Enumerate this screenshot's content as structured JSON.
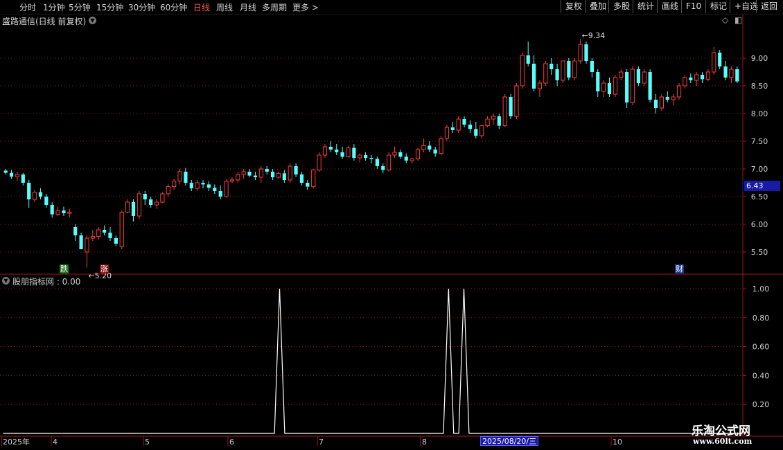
{
  "toolbar": {
    "left_items": [
      "分时",
      "1分钟",
      "5分钟",
      "15分钟",
      "30分钟",
      "60分钟",
      "日线",
      "周线",
      "月线",
      "多周期",
      "更多 >"
    ],
    "active": "日线",
    "right_items": [
      "复权",
      "叠加",
      "多股",
      "统计",
      "画线",
      "F10",
      "标记",
      "+自选",
      "返回"
    ]
  },
  "main_panel": {
    "title": "盛路通信(日线 前复权)",
    "current_price_label": "6.43",
    "high_marker": "9.34",
    "low_marker": "5.20",
    "badges": {
      "die": "跌",
      "zhang": "涨",
      "cai": "财"
    }
  },
  "indicator_panel": {
    "title": "股朋指标网 : 0.00"
  },
  "x_axis": {
    "labels": [
      "2025年",
      "4",
      "5",
      "6",
      "7",
      "8",
      "10"
    ],
    "cursor_date": "2025/08/20/三"
  },
  "watermark": {
    "line1": "乐淘公式网",
    "line2": "www.60lt.com"
  },
  "colors": {
    "up": "#ff3c3c",
    "down": "#54ffff",
    "grid": "#8a1a1a",
    "frame": "#a01818",
    "axis_text": "#d0d0d0"
  },
  "chart_data": [
    {
      "type": "candlestick",
      "title": "盛路通信(日线 前复权)",
      "yticks": [
        5.5,
        6.0,
        6.5,
        7.0,
        7.5,
        8.0,
        8.5,
        9.0
      ],
      "ylim": [
        5.1,
        9.55
      ],
      "max_marker": 9.34,
      "min_marker": 5.2,
      "last_price": 6.43,
      "ohlc": [
        [
          6.97,
          7.0,
          6.9,
          6.93
        ],
        [
          6.93,
          6.98,
          6.82,
          6.86
        ],
        [
          6.86,
          6.95,
          6.78,
          6.9
        ],
        [
          6.9,
          6.93,
          6.7,
          6.75
        ],
        [
          6.75,
          6.8,
          6.3,
          6.45
        ],
        [
          6.45,
          6.62,
          6.4,
          6.58
        ],
        [
          6.58,
          6.65,
          6.45,
          6.5
        ],
        [
          6.5,
          6.55,
          6.3,
          6.35
        ],
        [
          6.35,
          6.4,
          6.12,
          6.18
        ],
        [
          6.18,
          6.32,
          6.15,
          6.25
        ],
        [
          6.25,
          6.32,
          6.15,
          6.2
        ],
        [
          6.2,
          6.28,
          6.12,
          6.22
        ],
        [
          5.95,
          6.0,
          5.7,
          5.8
        ],
        [
          5.8,
          5.85,
          5.6,
          5.55
        ],
        [
          5.5,
          5.8,
          5.22,
          5.75
        ],
        [
          5.75,
          5.9,
          5.7,
          5.78
        ],
        [
          5.78,
          5.95,
          5.72,
          5.9
        ],
        [
          5.9,
          5.98,
          5.8,
          5.85
        ],
        [
          5.85,
          5.95,
          5.7,
          5.75
        ],
        [
          5.75,
          5.8,
          5.6,
          5.65
        ],
        [
          5.6,
          6.25,
          5.55,
          6.22
        ],
        [
          6.22,
          6.45,
          6.2,
          6.4
        ],
        [
          6.4,
          6.45,
          6.05,
          6.15
        ],
        [
          6.15,
          6.6,
          6.1,
          6.55
        ],
        [
          6.55,
          6.6,
          6.35,
          6.45
        ],
        [
          6.45,
          6.5,
          6.3,
          6.35
        ],
        [
          6.35,
          6.45,
          6.28,
          6.4
        ],
        [
          6.4,
          6.58,
          6.38,
          6.55
        ],
        [
          6.55,
          6.72,
          6.5,
          6.68
        ],
        [
          6.68,
          6.82,
          6.62,
          6.78
        ],
        [
          6.78,
          7.0,
          6.72,
          6.95
        ],
        [
          6.95,
          7.02,
          6.7,
          6.75
        ],
        [
          6.75,
          6.8,
          6.6,
          6.65
        ],
        [
          6.65,
          6.8,
          6.6,
          6.75
        ],
        [
          6.75,
          6.8,
          6.65,
          6.72
        ],
        [
          6.72,
          6.78,
          6.6,
          6.66
        ],
        [
          6.66,
          6.72,
          6.55,
          6.6
        ],
        [
          6.6,
          6.7,
          6.45,
          6.5
        ],
        [
          6.5,
          6.82,
          6.48,
          6.78
        ],
        [
          6.78,
          6.85,
          6.74,
          6.8
        ],
        [
          6.8,
          6.95,
          6.75,
          6.9
        ],
        [
          6.9,
          7.0,
          6.82,
          6.95
        ],
        [
          6.95,
          7.0,
          6.85,
          6.88
        ],
        [
          6.88,
          6.95,
          6.8,
          6.85
        ],
        [
          6.85,
          7.05,
          6.75,
          7.0
        ],
        [
          7.0,
          7.05,
          6.9,
          6.95
        ],
        [
          6.95,
          7.0,
          6.8,
          6.85
        ],
        [
          6.85,
          6.95,
          6.82,
          6.92
        ],
        [
          6.92,
          6.98,
          6.75,
          6.8
        ],
        [
          6.8,
          7.1,
          6.75,
          7.05
        ],
        [
          7.05,
          7.1,
          6.85,
          6.9
        ],
        [
          6.9,
          6.95,
          6.7,
          6.75
        ],
        [
          6.75,
          6.8,
          6.62,
          6.68
        ],
        [
          6.68,
          7.0,
          6.65,
          6.98
        ],
        [
          6.98,
          7.3,
          6.95,
          7.25
        ],
        [
          7.25,
          7.45,
          7.2,
          7.4
        ],
        [
          7.4,
          7.5,
          7.3,
          7.35
        ],
        [
          7.35,
          7.45,
          7.25,
          7.3
        ],
        [
          7.3,
          7.4,
          7.18,
          7.22
        ],
        [
          7.22,
          7.42,
          7.2,
          7.38
        ],
        [
          7.38,
          7.45,
          7.15,
          7.2
        ],
        [
          7.2,
          7.28,
          7.12,
          7.25
        ],
        [
          7.25,
          7.3,
          7.15,
          7.2
        ],
        [
          7.2,
          7.25,
          7.1,
          7.18
        ],
        [
          7.18,
          7.22,
          7.0,
          7.05
        ],
        [
          7.05,
          7.1,
          6.92,
          6.98
        ],
        [
          6.98,
          7.3,
          6.95,
          7.25
        ],
        [
          7.25,
          7.4,
          7.2,
          7.3
        ],
        [
          7.3,
          7.35,
          7.18,
          7.22
        ],
        [
          7.22,
          7.28,
          7.1,
          7.15
        ],
        [
          7.15,
          7.2,
          7.1,
          7.18
        ],
        [
          7.18,
          7.38,
          7.15,
          7.35
        ],
        [
          7.35,
          7.55,
          7.3,
          7.42
        ],
        [
          7.42,
          7.5,
          7.3,
          7.35
        ],
        [
          7.35,
          7.4,
          7.22,
          7.28
        ],
        [
          7.28,
          7.6,
          7.25,
          7.55
        ],
        [
          7.55,
          7.8,
          7.5,
          7.75
        ],
        [
          7.75,
          7.85,
          7.65,
          7.7
        ],
        [
          7.7,
          7.95,
          7.65,
          7.9
        ],
        [
          7.9,
          7.95,
          7.75,
          7.8
        ],
        [
          7.8,
          7.88,
          7.65,
          7.72
        ],
        [
          7.72,
          7.85,
          7.55,
          7.6
        ],
        [
          7.6,
          7.8,
          7.55,
          7.78
        ],
        [
          7.78,
          7.95,
          7.75,
          7.9
        ],
        [
          7.9,
          8.0,
          7.8,
          7.95
        ],
        [
          7.95,
          8.0,
          7.72,
          7.78
        ],
        [
          7.78,
          8.35,
          7.75,
          8.3
        ],
        [
          8.3,
          8.35,
          7.9,
          7.95
        ],
        [
          7.95,
          8.55,
          7.9,
          8.5
        ],
        [
          8.5,
          9.1,
          8.45,
          9.05
        ],
        [
          9.05,
          9.3,
          8.85,
          8.9
        ],
        [
          8.9,
          9.05,
          8.4,
          8.45
        ],
        [
          8.45,
          8.6,
          8.3,
          8.55
        ],
        [
          8.55,
          8.95,
          8.5,
          8.9
        ],
        [
          8.9,
          9.0,
          8.7,
          8.8
        ],
        [
          8.8,
          8.9,
          8.5,
          8.6
        ],
        [
          8.6,
          8.95,
          8.55,
          8.95
        ],
        [
          8.95,
          9.0,
          8.6,
          8.65
        ],
        [
          8.65,
          9.0,
          8.6,
          8.95
        ],
        [
          8.95,
          9.34,
          8.9,
          9.25
        ],
        [
          9.25,
          9.3,
          8.9,
          8.95
        ],
        [
          8.95,
          9.0,
          8.65,
          8.75
        ],
        [
          8.75,
          8.8,
          8.3,
          8.4
        ],
        [
          8.4,
          8.6,
          8.3,
          8.55
        ],
        [
          8.55,
          8.65,
          8.3,
          8.35
        ],
        [
          8.35,
          8.7,
          8.3,
          8.65
        ],
        [
          8.65,
          8.8,
          8.6,
          8.75
        ],
        [
          8.75,
          8.8,
          8.1,
          8.2
        ],
        [
          8.2,
          8.85,
          8.15,
          8.8
        ],
        [
          8.8,
          8.85,
          8.5,
          8.55
        ],
        [
          8.55,
          8.8,
          8.5,
          8.75
        ],
        [
          8.75,
          8.8,
          8.2,
          8.25
        ],
        [
          8.25,
          8.35,
          8.0,
          8.1
        ],
        [
          8.1,
          8.35,
          8.05,
          8.3
        ],
        [
          8.3,
          8.4,
          8.2,
          8.25
        ],
        [
          8.25,
          8.35,
          8.15,
          8.3
        ],
        [
          8.3,
          8.55,
          8.25,
          8.5
        ],
        [
          8.5,
          8.7,
          8.45,
          8.65
        ],
        [
          8.65,
          8.72,
          8.55,
          8.6
        ],
        [
          8.6,
          8.75,
          8.5,
          8.7
        ],
        [
          8.7,
          8.75,
          8.55,
          8.62
        ],
        [
          8.62,
          8.8,
          8.58,
          8.75
        ],
        [
          8.75,
          9.2,
          8.7,
          9.1
        ],
        [
          9.1,
          9.15,
          8.8,
          8.85
        ],
        [
          8.85,
          8.95,
          8.6,
          8.65
        ],
        [
          8.65,
          8.85,
          8.55,
          8.8
        ],
        [
          8.8,
          8.85,
          8.55,
          8.58
        ]
      ]
    },
    {
      "type": "line",
      "title": "股朋指标网",
      "current_value": 0.0,
      "yticks": [
        0.2,
        0.4,
        0.6,
        0.8,
        1.0
      ],
      "ylim": [
        0.0,
        1.05
      ],
      "x": [
        0,
        53,
        54,
        55,
        86,
        87,
        88,
        89,
        90,
        91,
        144
      ],
      "values": [
        0,
        0,
        1,
        0,
        0,
        1,
        0,
        0,
        1,
        0,
        0
      ]
    }
  ]
}
